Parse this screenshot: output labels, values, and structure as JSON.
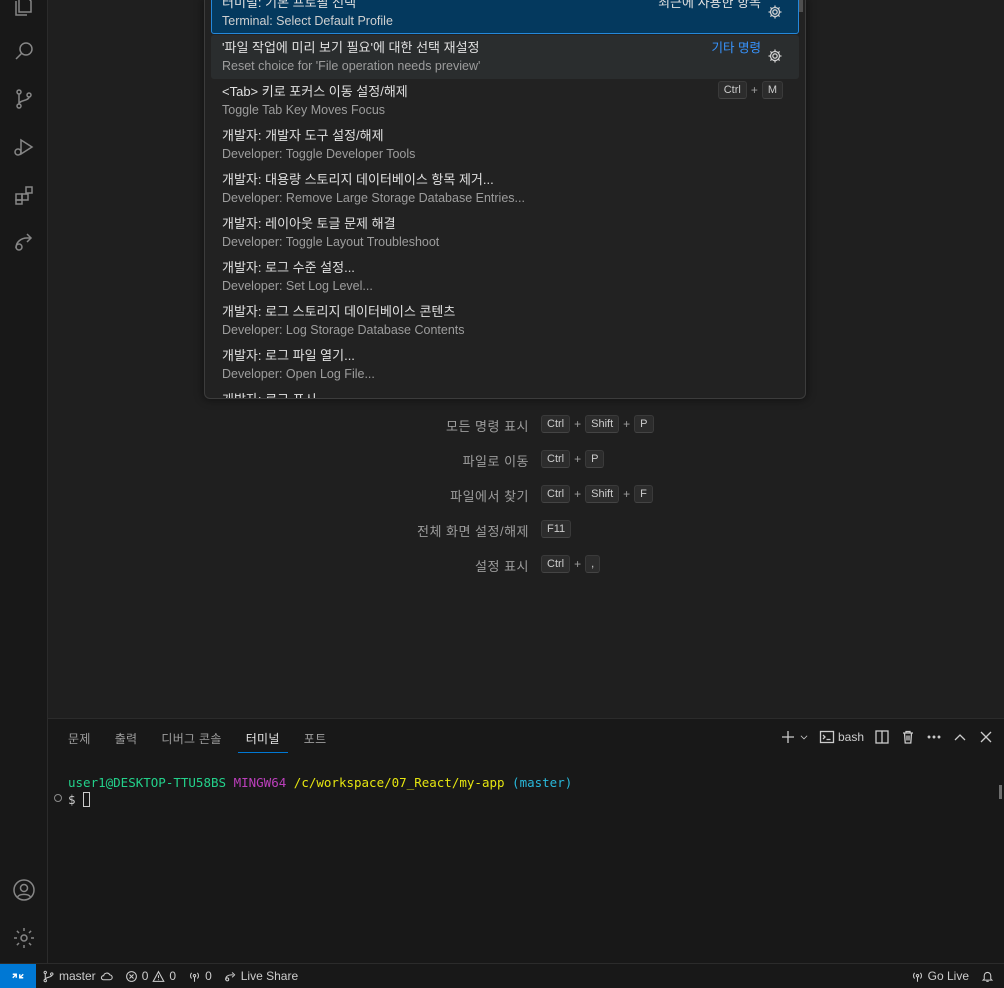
{
  "palette": {
    "items": [
      {
        "title": "터미널: 기본 프로필 선택",
        "subtitle": "Terminal: Select Default Profile",
        "right": "최근에 사용한 항목",
        "gear": true,
        "state": "selected"
      },
      {
        "title": "'파일 작업에 미리 보기 필요'에 대한 선택 재설정",
        "subtitle": "Reset choice for 'File operation needs preview'",
        "link": "기타 명령",
        "gear": true,
        "state": "hover"
      },
      {
        "title": "<Tab> 키로 포커스 이동 설정/해제",
        "subtitle": "Toggle Tab Key Moves Focus",
        "keys": [
          "Ctrl",
          "M"
        ]
      },
      {
        "title": "개발자: 개발자 도구 설정/해제",
        "subtitle": "Developer: Toggle Developer Tools"
      },
      {
        "title": "개발자: 대용량 스토리지 데이터베이스 항목 제거...",
        "subtitle": "Developer: Remove Large Storage Database Entries..."
      },
      {
        "title": "개발자: 레이아웃 토글 문제 해결",
        "subtitle": "Developer: Toggle Layout Troubleshoot"
      },
      {
        "title": "개발자: 로그 수준 설정...",
        "subtitle": "Developer: Set Log Level..."
      },
      {
        "title": "개발자: 로그 스토리지 데이터베이스 콘텐츠",
        "subtitle": "Developer: Log Storage Database Contents"
      },
      {
        "title": "개발자: 로그 파일 열기...",
        "subtitle": "Developer: Open Log File..."
      },
      {
        "title": "개발자: 로그 표시...",
        "subtitle": ""
      }
    ]
  },
  "shortcuts": [
    {
      "label": "모든 명령 표시",
      "keys": [
        "Ctrl",
        "Shift",
        "P"
      ]
    },
    {
      "label": "파일로 이동",
      "keys": [
        "Ctrl",
        "P"
      ]
    },
    {
      "label": "파일에서 찾기",
      "keys": [
        "Ctrl",
        "Shift",
        "F"
      ]
    },
    {
      "label": "전체 화면 설정/해제",
      "keys": [
        "F11"
      ]
    },
    {
      "label": "설정 표시",
      "keys": [
        "Ctrl",
        ","
      ]
    }
  ],
  "panel": {
    "tabs": [
      "문제",
      "출력",
      "디버그 콘솔",
      "터미널",
      "포트"
    ],
    "active_tab": "터미널",
    "shell": "bash"
  },
  "terminal": {
    "user": "user1@DESKTOP-TTU58BS",
    "env": "MINGW64",
    "path": "/c/workspace/07_React/my-app",
    "branch": "(master)",
    "prompt": "$"
  },
  "status": {
    "branch": "master",
    "errors": "0",
    "warnings": "0",
    "ports": "0",
    "live_share": "Live Share",
    "go_live": "Go Live"
  },
  "colors": {
    "accent": "#0078d4",
    "selected_bg": "#04395e",
    "link": "#3794ff"
  }
}
